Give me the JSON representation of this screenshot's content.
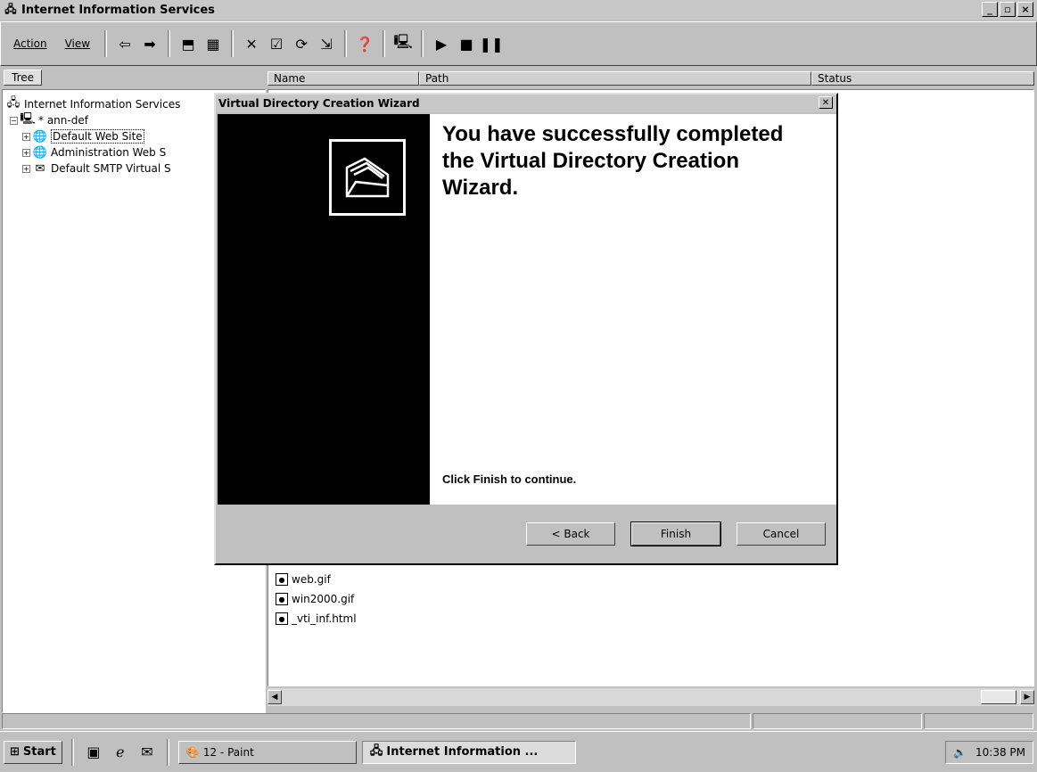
{
  "window": {
    "title": "Internet Information Services",
    "minimize": "_",
    "maximize": "▫",
    "close": "×"
  },
  "menu": {
    "action": "Action",
    "view": "View"
  },
  "tree": {
    "tab": "Tree",
    "root": "Internet Information Services",
    "server": "* ann-def",
    "sites": [
      "Default Web Site",
      "Administration Web S",
      "Default SMTP Virtual S"
    ]
  },
  "columns": {
    "name": "Name",
    "path": "Path",
    "status": "Status"
  },
  "files": [
    "web.gif",
    "win2000.gif",
    "_vti_inf.html"
  ],
  "dialog": {
    "title": "Virtual Directory Creation Wizard",
    "heading": "You have successfully completed the Virtual Directory Creation Wizard.",
    "prompt": "Click Finish to continue.",
    "back": "< Back",
    "finish": "Finish",
    "cancel": "Cancel"
  },
  "taskbar": {
    "start": "Start",
    "tasks": [
      "12 - Paint",
      "Internet Information ..."
    ],
    "clock": "10:38 PM"
  },
  "colors": {
    "dialog_panel": "#000000",
    "chrome": "#c0c0c0"
  }
}
